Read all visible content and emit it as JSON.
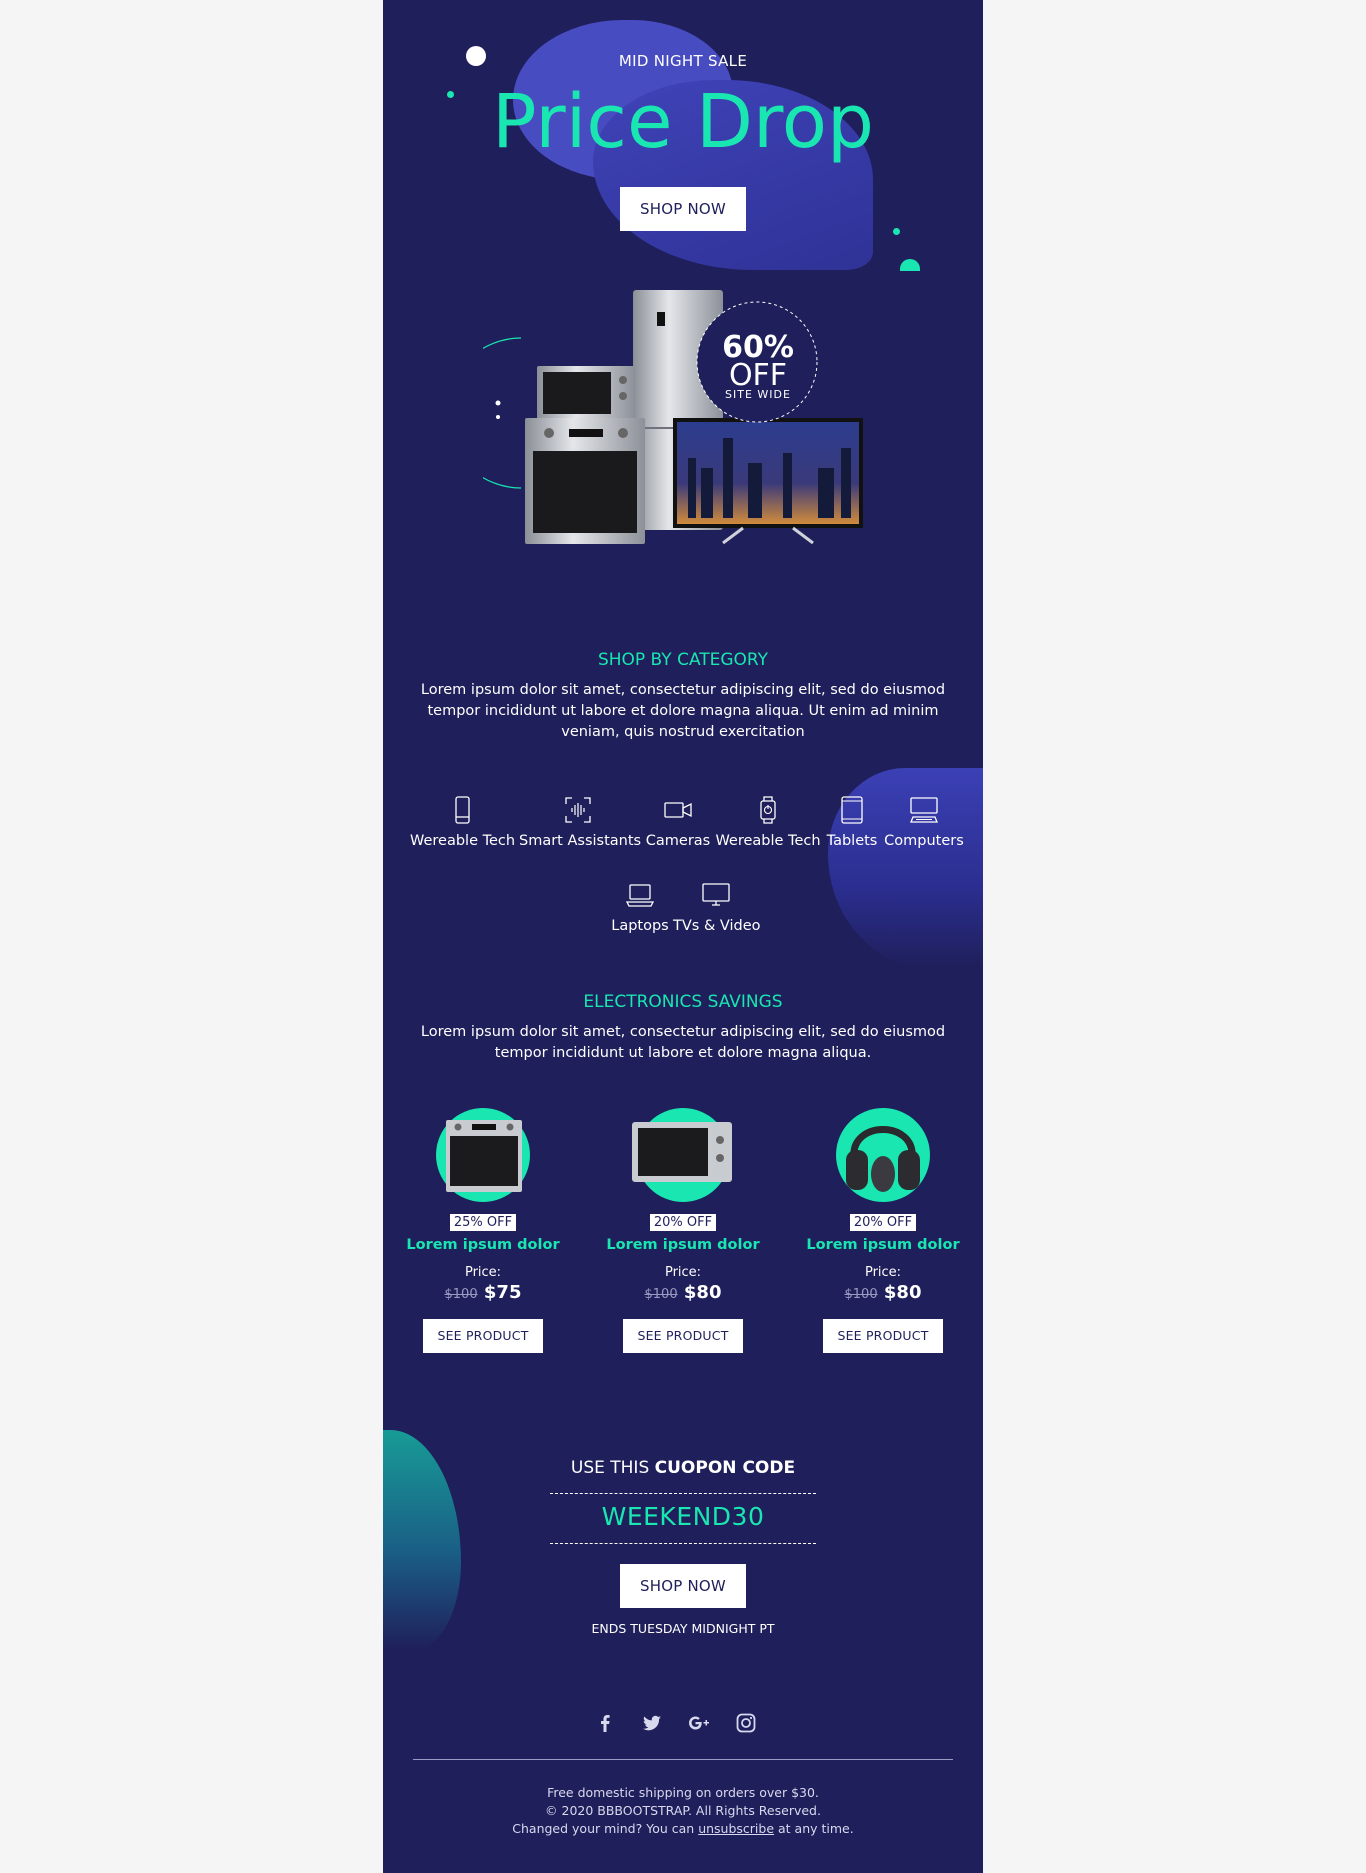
{
  "hero": {
    "eyebrow": "MID NIGHT SALE",
    "title": "Price Drop",
    "cta": "SHOP NOW",
    "badge_percent": "60%",
    "badge_off": "OFF",
    "badge_scope": "SITE WIDE"
  },
  "category": {
    "title": "SHOP BY CATEGORY",
    "text": "Lorem ipsum dolor sit amet, consectetur adipiscing elit, sed do eiusmod tempor incididunt ut labore et dolore magna aliqua. Ut enim ad minim veniam, quis nostrud exercitation",
    "items": [
      {
        "label": "Wereable Tech",
        "icon": "smartphone-icon"
      },
      {
        "label": "Smart Assistants",
        "icon": "voice-assistant-icon"
      },
      {
        "label": "Cameras",
        "icon": "video-camera-icon"
      },
      {
        "label": "Wereable Tech",
        "icon": "smartwatch-icon"
      },
      {
        "label": "Tablets",
        "icon": "tablet-icon"
      },
      {
        "label": "Computers",
        "icon": "desktop-computer-icon"
      },
      {
        "label": "Laptops",
        "icon": "laptop-icon"
      },
      {
        "label": "TVs & Video",
        "icon": "tv-icon"
      }
    ]
  },
  "savings": {
    "title": "ELECTRONICS SAVINGS",
    "text": "Lorem ipsum dolor sit amet, consectetur adipiscing elit, sed do eiusmod tempor incididunt ut labore et dolore magna aliqua.",
    "products": [
      {
        "badge": "25% OFF",
        "name": "Lorem ipsum dolor",
        "price_label": "Price:",
        "old_price": "$100",
        "price": "$75",
        "cta": "SEE PRODUCT",
        "image": "oven"
      },
      {
        "badge": "20% OFF",
        "name": "Lorem ipsum dolor",
        "price_label": "Price:",
        "old_price": "$100",
        "price": "$80",
        "cta": "SEE PRODUCT",
        "image": "microwave"
      },
      {
        "badge": "20% OFF",
        "name": "Lorem ipsum dolor",
        "price_label": "Price:",
        "old_price": "$100",
        "price": "$80",
        "cta": "SEE PRODUCT",
        "image": "headphones"
      }
    ]
  },
  "coupon": {
    "prefix": "USE THIS",
    "emphasis": "CUOPON CODE",
    "code": "WEEKEND30",
    "cta": "SHOP NOW",
    "ends": "ENDS TUESDAY MIDNIGHT PT"
  },
  "social": [
    "facebook-icon",
    "twitter-icon",
    "google-plus-icon",
    "instagram-icon"
  ],
  "footer": {
    "shipping": "Free domestic shipping on orders over $30.",
    "copyright": "© 2020 BBBOOTSTRAP. All Rights Reserved.",
    "unsub_prefix": "Changed your mind? You can",
    "unsub_link": "unsubscribe",
    "unsub_suffix": "at any time."
  },
  "colors": {
    "background": "#1f1f5b",
    "accent": "#19e6b0",
    "blob": "#4b4fc7",
    "page": "#f5f5f5"
  }
}
